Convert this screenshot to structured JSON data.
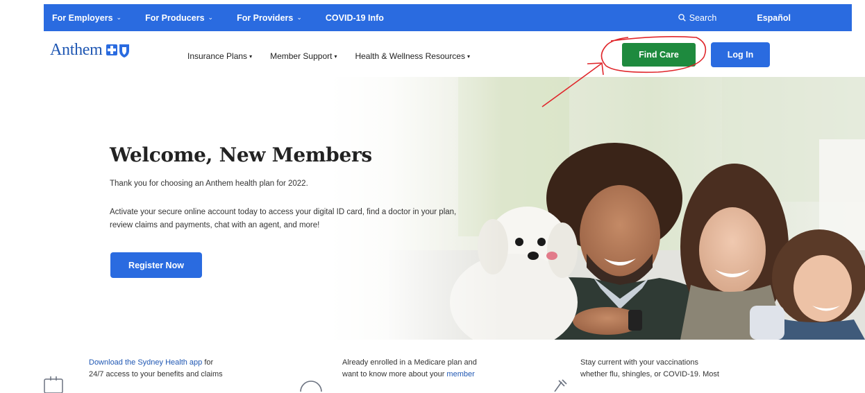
{
  "topbar": {
    "links": [
      {
        "label": "For Employers",
        "chevron": "chevron-down-icon"
      },
      {
        "label": "For Producers",
        "chevron": "chevron-down-icon"
      },
      {
        "label": "For Providers",
        "chevron": "chevron-down-icon"
      },
      {
        "label": "COVID-19 Info"
      }
    ],
    "search_label": "Search",
    "language_label": "Español",
    "background_color": "#2a6be0"
  },
  "navbar": {
    "logo_text": "Anthem",
    "menu": [
      {
        "label": "Insurance Plans"
      },
      {
        "label": "Member Support"
      },
      {
        "label": "Health & Wellness Resources"
      }
    ],
    "find_care_label": "Find Care",
    "login_label": "Log In",
    "find_care_color": "#1e8a3e",
    "login_color": "#2a6be0"
  },
  "hero": {
    "title": "Welcome, New Members",
    "subtitle": "Thank you for choosing an Anthem health plan for 2022.",
    "body": "Activate your secure online account today to access your digital ID card, find a doctor in your plan, review claims and payments, chat with an agent, and more!",
    "cta_label": "Register Now"
  },
  "cards": [
    {
      "icon": "phone-app-icon",
      "link": "Download the Sydney Health app",
      "line1_rest": " for",
      "line2": "24/7 access to your benefits and claims"
    },
    {
      "icon": "circle-icon",
      "line1": "Already enrolled in a Medicare plan and",
      "line2_start": "want to know more about your ",
      "line2_link": "member"
    },
    {
      "icon": "syringe-icon",
      "line1": "Stay current with your vaccinations",
      "line2": "whether flu, shingles, or COVID-19. Most"
    }
  ],
  "annotation_color": "#e0262b"
}
